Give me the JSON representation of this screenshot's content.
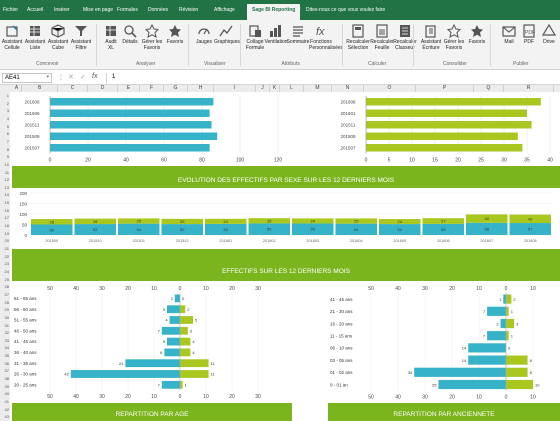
{
  "menubar": {
    "items": [
      "Fichier",
      "Accueil",
      "Insérer",
      "Mise en page",
      "Formules",
      "Données",
      "Révision",
      "Affichage",
      "Sage BI Reporting"
    ],
    "active_index": 8,
    "tellme": "Dites-nous ce que vous voulez faire"
  },
  "ribbon": {
    "buttons": [
      {
        "label": "Assistant\nCellule",
        "icon": "cell-icon"
      },
      {
        "label": "Assistant\nListe",
        "icon": "list-icon"
      },
      {
        "label": "Assistant\nCube",
        "icon": "cube-icon"
      },
      {
        "label": "Assistant\nFiltre",
        "icon": "filter-icon"
      },
      {
        "label": "Audit\nXL",
        "icon": "audit-icon"
      },
      {
        "label": "Détails",
        "icon": "details-icon"
      },
      {
        "label": "Gérer les\nFavoris",
        "icon": "manage-favorites-icon"
      },
      {
        "label": "Favoris",
        "icon": "star-icon"
      },
      {
        "label": "Jauges",
        "icon": "gauge-icon"
      },
      {
        "label": "Graphiques",
        "icon": "chart-icon"
      },
      {
        "label": "Collage\nFormule",
        "icon": "paste-formula-icon"
      },
      {
        "label": "Ventilation",
        "icon": "breakdown-icon"
      },
      {
        "label": "Sommaire",
        "icon": "summary-icon"
      },
      {
        "label": "Fonctions\nPersonnalisées",
        "icon": "function-icon"
      },
      {
        "label": "Recalculer\nSélection",
        "icon": "recalc-selection-icon"
      },
      {
        "label": "Recalculer\nFeuille",
        "icon": "recalc-sheet-icon"
      },
      {
        "label": "Recalculer\nClasseur",
        "icon": "recalc-workbook-icon"
      },
      {
        "label": "Assistant\nÉcriture",
        "icon": "write-icon"
      },
      {
        "label": "Gérer les\nFavoris",
        "icon": "manage-favorites-icon"
      },
      {
        "label": "Favoris",
        "icon": "star-icon"
      },
      {
        "label": "Mail",
        "icon": "mail-icon"
      },
      {
        "label": "PDF",
        "icon": "pdf-icon"
      },
      {
        "label": "Drive",
        "icon": "drive-icon"
      }
    ],
    "groups": [
      "Concevoir",
      "Analyser",
      "Visualiser",
      "Attributs",
      "Calculer",
      "Consolider",
      "Publier"
    ]
  },
  "formula_bar": {
    "cell_ref": "AE41",
    "fx": "fx",
    "value": "1"
  },
  "sheet": {
    "columns": [
      "A",
      "B",
      "C",
      "D",
      "E",
      "F",
      "G",
      "H",
      "I",
      "J",
      "K",
      "L",
      "M",
      "N",
      "O",
      "P",
      "Q",
      "R"
    ],
    "rows": [
      "1",
      "2",
      "3",
      "4",
      "5",
      "6",
      "7",
      "8",
      "9",
      "10",
      "11",
      "12",
      "13",
      "14",
      "15",
      "16",
      "17",
      "18",
      "19",
      "20",
      "21",
      "22",
      "23",
      "24",
      "25",
      "26",
      "27",
      "28",
      "29",
      "30",
      "31",
      "32",
      "33",
      "34",
      "35",
      "36",
      "37",
      "38",
      "39",
      "40",
      "41",
      "42",
      "43"
    ]
  },
  "colors": {
    "teal": "#36b3c9",
    "green": "#a9c71f",
    "band": "#7ab51d",
    "excel": "#217346"
  },
  "bands": {
    "sexe": "EVOLUTION DES EFFECTIFS PAR SEXE SUR LES 12 DERNIERS MOIS",
    "effectifs": "EFFECTIFS SUR LES 12 DERNIERS MOIS",
    "age": "REPARTITION PAR AGE",
    "anciennete": "REPARTITION PAR ANCIENNETE"
  },
  "chart_data": [
    {
      "type": "bar",
      "orientation": "horizontal",
      "categories": [
        "201608",
        "201606",
        "201511",
        "201509",
        "201507"
      ],
      "values": [
        86,
        84,
        85,
        88,
        84
      ],
      "color": "#36b3c9",
      "xlim": [
        0,
        120
      ],
      "xticks": [
        "0",
        "20",
        "40",
        "60",
        "80",
        "100",
        "120"
      ]
    },
    {
      "type": "bar",
      "orientation": "horizontal",
      "categories": [
        "201608",
        "201601",
        "201511",
        "201509",
        "201507"
      ],
      "values": [
        38,
        35,
        36,
        33,
        34
      ],
      "color": "#a9c71f",
      "xlim": [
        0,
        40
      ],
      "xticks": [
        "0",
        "5",
        "10",
        "15",
        "20",
        "25",
        "30",
        "35",
        "40"
      ]
    },
    {
      "type": "bar",
      "stacked": true,
      "ylim": [
        0,
        200
      ],
      "yticks": [
        "0",
        "50",
        "100",
        "150",
        "200"
      ],
      "series": [
        {
          "color": "#36b3c9",
          "values": [
            50,
            52,
            54,
            52,
            53,
            55,
            55,
            54,
            52,
            53,
            58,
            57
          ]
        },
        {
          "color": "#a9c71f",
          "values": [
            26,
            26,
            25,
            25,
            24,
            25,
            24,
            25,
            24,
            27,
            40,
            40
          ]
        }
      ],
      "categories": [
        "201509",
        "201510",
        "201511",
        "201512",
        "201601",
        "201602",
        "201603",
        "201604",
        "201605",
        "201606",
        "201607",
        "201608"
      ]
    },
    {
      "type": "bar",
      "orientation": "horizontal",
      "diverging": true,
      "categories": [
        "61 - 65 ans",
        "56 - 60 ans",
        "51 - 55 ans",
        "46 - 50 ans",
        "41 - 45 ans",
        "36 - 40 ans",
        "31 - 35 ans",
        "26 - 30 ans",
        "20 - 25 ans"
      ],
      "left_values": [
        2,
        5,
        4,
        7,
        5,
        6,
        21,
        42,
        7
      ],
      "right_values": [
        0,
        2,
        5,
        3,
        4,
        4,
        11,
        11,
        1
      ],
      "xticks_left": [
        "50",
        "40",
        "30",
        "20",
        "10",
        "0"
      ],
      "xticks_right": [
        "10",
        "20",
        "30"
      ]
    },
    {
      "type": "bar",
      "orientation": "horizontal",
      "diverging": true,
      "categories": [
        "41 - 45 ans",
        "21 - 30 ans",
        "16 - 20 ans",
        "11 - 15 ans",
        "06 - 10 ans",
        "03 - 05 ans",
        "01 - 02 ans",
        "0 - 01 an"
      ],
      "left_values": [
        1,
        7,
        2,
        7,
        14,
        14,
        34,
        25
      ],
      "right_values": [
        2,
        1,
        3,
        1,
        0,
        8,
        8,
        10
      ],
      "xticks_left": [
        "50",
        "40",
        "30",
        "20",
        "10",
        "0"
      ],
      "xticks_right": [
        "10",
        "20"
      ]
    }
  ]
}
